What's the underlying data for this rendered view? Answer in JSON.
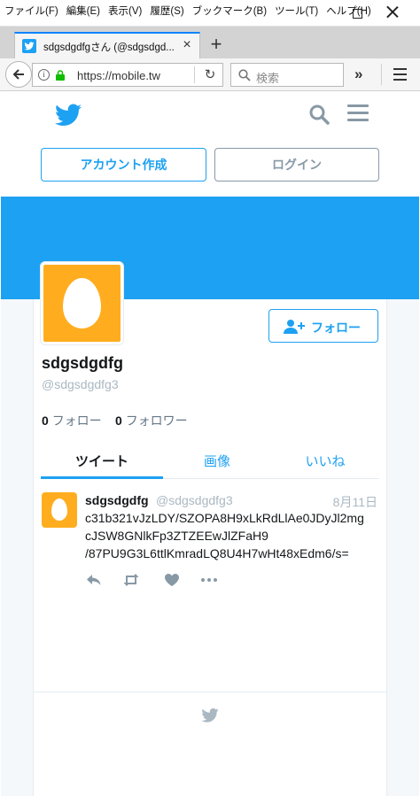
{
  "browser": {
    "menus": [
      "ファイル(F)",
      "編集(E)",
      "表示(V)",
      "履歴(S)",
      "ブックマーク(B)",
      "ツール(T)",
      "ヘルプ(H)"
    ],
    "tab_title": "sdgsdgdfgさん (@sdgsdgd...",
    "new_tab_label": "+",
    "url": "https://mobile.tw",
    "search_placeholder": "検索",
    "overflow_label": "»"
  },
  "header": {
    "signup_label": "アカウント作成",
    "login_label": "ログイン"
  },
  "profile": {
    "display_name": "sdgsdgdfg",
    "screen_name": "@sdgsdgdfg3",
    "follow_label": "フォロー",
    "following_count": "0",
    "following_label": "フォロー",
    "followers_count": "0",
    "followers_label": "フォロワー"
  },
  "tabs": {
    "tweets": "ツイート",
    "media": "画像",
    "likes": "いいね"
  },
  "tweet": {
    "name": "sdgsdgdfg",
    "handle": "@sdgsdgdfg3",
    "date": "8月11日",
    "text_lines": [
      "c31b321vJzLDY/SZOPA8H9xLkRdLlAe0JDyJl2mg",
      "cJSW8GNlkFp3ZTZEEwJlZFaH9",
      "/87PU9G3L6ttlKmradLQ8U4H7wHt48xEdm6/s="
    ]
  },
  "colors": {
    "accent": "#1da1f2",
    "avatar_bg": "#ffad1f",
    "muted": "#8899a6"
  }
}
